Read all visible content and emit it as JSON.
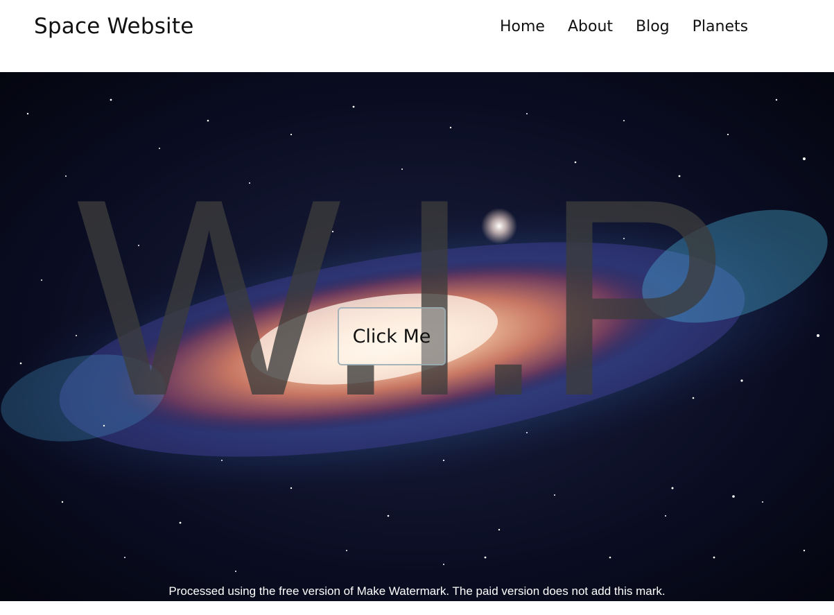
{
  "header": {
    "site_title": "Space Website",
    "nav": [
      {
        "label": "Home"
      },
      {
        "label": "About"
      },
      {
        "label": "Blog"
      },
      {
        "label": "Planets"
      }
    ]
  },
  "hero": {
    "background_image": "galaxy",
    "overlay_text": "W.I.P",
    "cta_label": "Click Me",
    "watermark": "Processed using the free version of Make Watermark. The paid version does not add this mark."
  },
  "colors": {
    "header_bg": "#ffffff",
    "text": "#111111",
    "space_bg": "#050614"
  }
}
